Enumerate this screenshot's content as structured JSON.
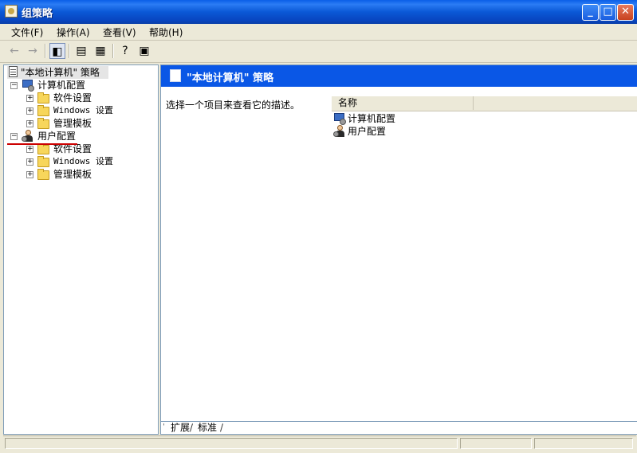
{
  "window": {
    "title": "组策略"
  },
  "menu": [
    "文件(F)",
    "操作(A)",
    "查看(V)",
    "帮助(H)"
  ],
  "toolbar": {
    "back_icon": "arrow-left-icon",
    "forward_icon": "arrow-right-icon"
  },
  "tree": {
    "root": "\"本地计算机\" 策略",
    "computer": "计算机配置",
    "computer_children": [
      "软件设置",
      "Windows 设置",
      "管理模板"
    ],
    "user": "用户配置",
    "user_children": [
      "软件设置",
      "Windows 设置",
      "管理模板"
    ]
  },
  "right": {
    "header": "\"本地计算机\" 策略",
    "description": "选择一个项目来查看它的描述。",
    "column_name": "名称",
    "items": [
      "计算机配置",
      "用户配置"
    ],
    "tabs": [
      "扩展",
      "标准"
    ]
  },
  "colors": {
    "titlebar": "#0a58d6",
    "header_band": "#0a57e6",
    "selection_underline": "#cc0000"
  }
}
